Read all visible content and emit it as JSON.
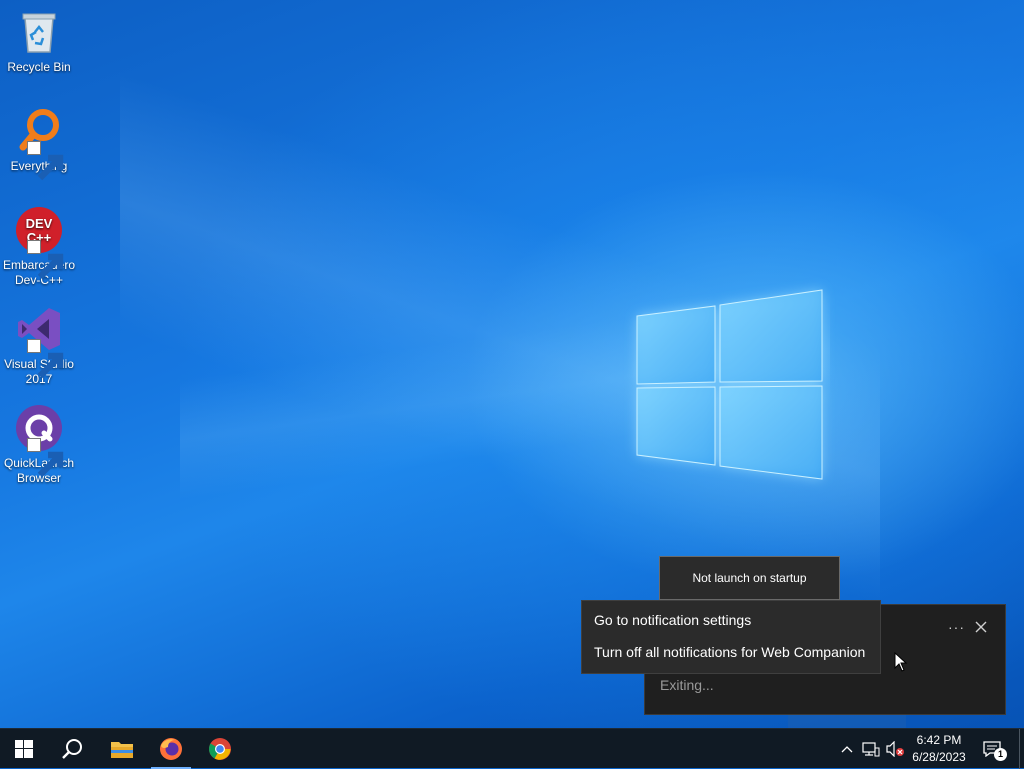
{
  "desktop": {
    "icons": [
      {
        "label": "Recycle Bin",
        "icon": "recycle-bin-icon",
        "shortcut": false
      },
      {
        "label": "Everything",
        "icon": "everything-magnifier-icon",
        "shortcut": true
      },
      {
        "label": "Embarcadero Dev-C++",
        "icon": "dev-cpp-icon",
        "shortcut": true,
        "icon_text": "DEV C++"
      },
      {
        "label": "Visual Studio 2017",
        "icon": "visual-studio-icon",
        "shortcut": true
      },
      {
        "label": "QuickLaunch Browser",
        "icon": "quicklaunch-browser-icon",
        "shortcut": true
      }
    ]
  },
  "tooltip": {
    "text": "Not launch on startup"
  },
  "toast": {
    "status": "Exiting...",
    "more_label": "···"
  },
  "context_menu": {
    "items": [
      {
        "label": "Go to notification settings"
      },
      {
        "label": "Turn off all notifications for Web Companion"
      }
    ]
  },
  "taskbar": {
    "apps": [
      "start-icon",
      "search-icon",
      "file-explorer-icon",
      "firefox-icon",
      "chrome-icon"
    ],
    "tray_icons": [
      "chevron-up-icon",
      "network-icon",
      "volume-muted-icon"
    ],
    "time": "6:42 PM",
    "date": "6/28/2023",
    "notification_count": "1"
  },
  "colors": {
    "accent": "#0a63c9",
    "taskbar": "#101a24",
    "popup": "#2b2b2b"
  }
}
